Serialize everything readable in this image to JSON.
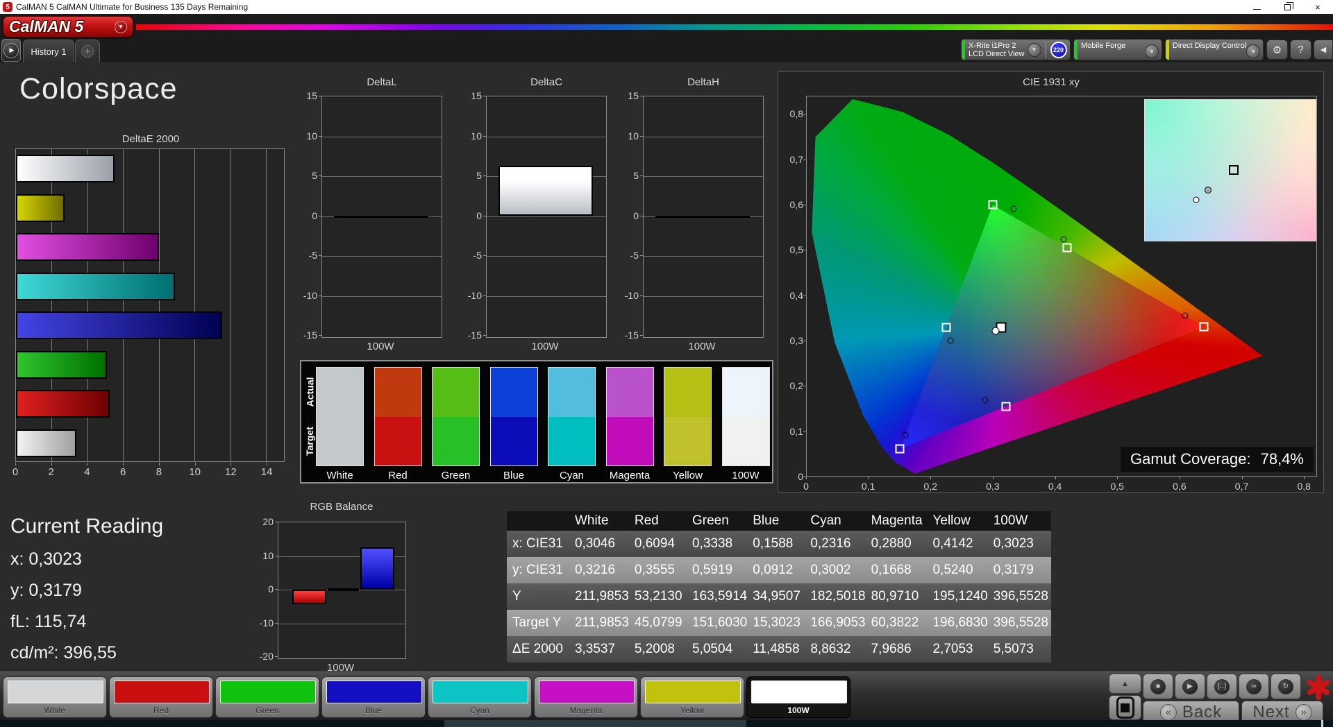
{
  "window": {
    "title": "CalMAN 5 CalMAN Ultimate for Business 135 Days Remaining",
    "app_badge": "5"
  },
  "icons": {
    "minimize": "minimize",
    "restore": "restore",
    "close": "×",
    "dropdown": "▼",
    "sidebar_play": "▶",
    "gear": "⚙",
    "help": "?",
    "collapse": "◀",
    "up": "▲",
    "stop": "■",
    "play": "▶",
    "loop": "[‥]",
    "continuous": "∞",
    "refresh": "↻",
    "back_chevron": "«",
    "next_chevron": "»",
    "plus": "+"
  },
  "header": {
    "logo": "CalMAN 5",
    "tabs": [
      {
        "label": "History 1"
      },
      {
        "label": "+"
      }
    ],
    "meter": {
      "line1": "X-Rite i1Pro 2",
      "line2": "LCD Direct View",
      "badge": "220"
    },
    "pattern_source": "Mobile Forge",
    "display_control": "Direct Display Control"
  },
  "page": {
    "title": "Colorspace"
  },
  "current_reading": {
    "title": "Current Reading",
    "lines": [
      {
        "label": "x:",
        "value": "0,3023"
      },
      {
        "label": "y:",
        "value": "0,3179"
      },
      {
        "label": "fL:",
        "value": "115,74"
      },
      {
        "label": "cd/m²:",
        "value": "396,55"
      }
    ]
  },
  "swatches": {
    "row_labels": [
      "Actual",
      "Target"
    ],
    "items": [
      {
        "label": "White",
        "actual": "#c3c8cd",
        "target": "#c3c8ca"
      },
      {
        "label": "Red",
        "actual": "#c0390f",
        "target": "#c91111"
      },
      {
        "label": "Green",
        "actual": "#55bd15",
        "target": "#27c027"
      },
      {
        "label": "Blue",
        "actual": "#0c40d6",
        "target": "#0c0cb8"
      },
      {
        "label": "Cyan",
        "actual": "#52bddc",
        "target": "#00bdbf"
      },
      {
        "label": "Magenta",
        "actual": "#ba52cc",
        "target": "#c00cba"
      },
      {
        "label": "Yellow",
        "actual": "#b6c116",
        "target": "#c1c12c"
      },
      {
        "label": "100W",
        "actual": "#eef4fb",
        "target": "#f0f2ef"
      }
    ]
  },
  "table": {
    "columns": [
      "",
      "White",
      "Red",
      "Green",
      "Blue",
      "Cyan",
      "Magenta",
      "Yellow",
      "100W"
    ],
    "rows": [
      {
        "label": "x: CIE31",
        "shade": "dark",
        "values": [
          "0,3046",
          "0,6094",
          "0,3338",
          "0,1588",
          "0,2316",
          "0,2880",
          "0,4142",
          "0,3023"
        ]
      },
      {
        "label": "y: CIE31",
        "shade": "light",
        "values": [
          "0,3216",
          "0,3555",
          "0,5919",
          "0,0912",
          "0,3002",
          "0,1668",
          "0,5240",
          "0,3179"
        ]
      },
      {
        "label": "Y",
        "shade": "dark",
        "values": [
          "211,9853",
          "53,2130",
          "163,5914",
          "34,9507",
          "182,5018",
          "80,9710",
          "195,1240",
          "396,5528"
        ]
      },
      {
        "label": "Target Y",
        "shade": "light",
        "values": [
          "211,9853",
          "45,0799",
          "151,6030",
          "15,3023",
          "166,9053",
          "60,3822",
          "196,6830",
          "396,5528"
        ]
      },
      {
        "label": "ΔE 2000",
        "shade": "dark",
        "values": [
          "3,3537",
          "5,2008",
          "5,0504",
          "11,4858",
          "8,8632",
          "7,9686",
          "2,7053",
          "5,5073"
        ]
      }
    ]
  },
  "bottom_bar": {
    "patches": [
      {
        "label": "White",
        "color": "#d4d6d8",
        "selected": false
      },
      {
        "label": "Red",
        "color": "#c90f0f",
        "selected": false
      },
      {
        "label": "Green",
        "color": "#0ec20e",
        "selected": false
      },
      {
        "label": "Blue",
        "color": "#140fc2",
        "selected": false
      },
      {
        "label": "Cyan",
        "color": "#0cc4c4",
        "selected": false
      },
      {
        "label": "Magenta",
        "color": "#c610c6",
        "selected": false
      },
      {
        "label": "Yellow",
        "color": "#c2c20e",
        "selected": false
      },
      {
        "label": "100W",
        "color": "#ffffff",
        "selected": true
      }
    ],
    "back_label": "Back",
    "next_label": "Next"
  },
  "chart_data": [
    {
      "type": "bar",
      "orientation": "horizontal",
      "title": "DeltaE 2000",
      "categories": [
        "100W",
        "Yellow",
        "Magenta",
        "Cyan",
        "Blue",
        "Green",
        "Red",
        "White"
      ],
      "values": [
        5.5073,
        2.7053,
        7.9686,
        8.8632,
        11.4858,
        5.0504,
        5.2008,
        3.3537
      ],
      "colors": [
        "c100w",
        "yellow",
        "magenta",
        "cyan",
        "blue",
        "green",
        "red",
        "white"
      ],
      "xlim": [
        0,
        15
      ],
      "xticks": {
        "labels": [
          "0",
          "2",
          "4",
          "6",
          "8",
          "10",
          "12",
          "14"
        ],
        "values": [
          0,
          2,
          4,
          6,
          8,
          10,
          12,
          14
        ]
      }
    },
    {
      "type": "bar",
      "orientation": "vertical",
      "title": "DeltaL",
      "xlabel": "100W",
      "ylim": [
        -15,
        15
      ],
      "yticks": {
        "labels": [
          "15",
          "10",
          "5",
          "0",
          "-5",
          "-10",
          "-15"
        ],
        "values": [
          15,
          10,
          5,
          0,
          -5,
          -10,
          -15
        ]
      },
      "bars": [
        {
          "name": "100W",
          "value": 0,
          "color": "zero",
          "x0": 0.1,
          "x1": 0.9
        }
      ]
    },
    {
      "type": "bar",
      "orientation": "vertical",
      "title": "DeltaC",
      "xlabel": "100W",
      "ylim": [
        -15,
        15
      ],
      "yticks": {
        "labels": [
          "15",
          "10",
          "5",
          "0",
          "-5",
          "-10",
          "-15"
        ],
        "values": [
          15,
          10,
          5,
          0,
          -5,
          -10,
          -15
        ]
      },
      "bars": [
        {
          "name": "100W",
          "value": 6.3,
          "color": "whitebar",
          "x0": 0.1,
          "x1": 0.9
        }
      ]
    },
    {
      "type": "bar",
      "orientation": "vertical",
      "title": "DeltaH",
      "xlabel": "100W",
      "ylim": [
        -15,
        15
      ],
      "yticks": {
        "labels": [
          "15",
          "10",
          "5",
          "0",
          "-5",
          "-10",
          "-15"
        ],
        "values": [
          15,
          10,
          5,
          0,
          -5,
          -10,
          -15
        ]
      },
      "bars": [
        {
          "name": "100W",
          "value": 0,
          "color": "zero",
          "x0": 0.1,
          "x1": 0.9
        }
      ]
    },
    {
      "type": "bar",
      "orientation": "vertical",
      "title": "RGB Balance",
      "xlabel": "100W",
      "ylim": [
        -20,
        20
      ],
      "yticks": {
        "labels": [
          "20",
          "10",
          "0",
          "-10",
          "-20"
        ],
        "values": [
          20,
          10,
          0,
          -10,
          -20
        ]
      },
      "bars": [
        {
          "name": "Red",
          "value": -4.3,
          "color": "red",
          "x0": 0.11,
          "x1": 0.38
        },
        {
          "name": "Green",
          "value": 0.5,
          "color": "green",
          "x0": 0.39,
          "x1": 0.64
        },
        {
          "name": "Blue",
          "value": 12.6,
          "color": "blue",
          "x0": 0.65,
          "x1": 0.92
        }
      ]
    },
    {
      "type": "scatter",
      "title": "CIE 1931 xy",
      "xmax": 0.821,
      "ymax": 0.84,
      "xticks": {
        "labels": [
          "0",
          "0,1",
          "0,2",
          "0,3",
          "0,4",
          "0,5",
          "0,6",
          "0,7",
          "0,8"
        ],
        "values": [
          0,
          0.1,
          0.2,
          0.3,
          0.4,
          0.5,
          0.6,
          0.7,
          0.8
        ]
      },
      "yticks": {
        "labels": [
          "0,8",
          "0,7",
          "0,6",
          "0,5",
          "0,4",
          "0,3",
          "0,2",
          "0,1",
          "0"
        ],
        "values": [
          0.8,
          0.7,
          0.6,
          0.5,
          0.4,
          0.3,
          0.2,
          0.1,
          0
        ]
      },
      "targets": [
        {
          "name": "red",
          "x": 0.64,
          "y": 0.33
        },
        {
          "name": "green",
          "x": 0.3,
          "y": 0.6
        },
        {
          "name": "blue",
          "x": 0.15,
          "y": 0.06
        },
        {
          "name": "cyan",
          "x": 0.225,
          "y": 0.329
        },
        {
          "name": "magenta",
          "x": 0.321,
          "y": 0.154
        },
        {
          "name": "yellow",
          "x": 0.419,
          "y": 0.505
        }
      ],
      "white_target": {
        "x": 0.3127,
        "y": 0.329
      },
      "measured": [
        {
          "name": "red",
          "x": 0.6094,
          "y": 0.3555
        },
        {
          "name": "green",
          "x": 0.3338,
          "y": 0.5919
        },
        {
          "name": "blue",
          "x": 0.1588,
          "y": 0.0912
        },
        {
          "name": "cyan",
          "x": 0.2316,
          "y": 0.3002
        },
        {
          "name": "magenta",
          "x": 0.288,
          "y": 0.1668
        },
        {
          "name": "yellow",
          "x": 0.4142,
          "y": 0.524
        }
      ],
      "white_measured": {
        "x": 0.3046,
        "y": 0.3216
      },
      "inset": {
        "square": [
          0.52,
          0.5
        ],
        "gray_circle": [
          0.37,
          0.64
        ],
        "white_circle": [
          0.3,
          0.71
        ]
      },
      "gamut_coverage": {
        "label": "Gamut Coverage:",
        "value": "78,4%"
      }
    }
  ]
}
